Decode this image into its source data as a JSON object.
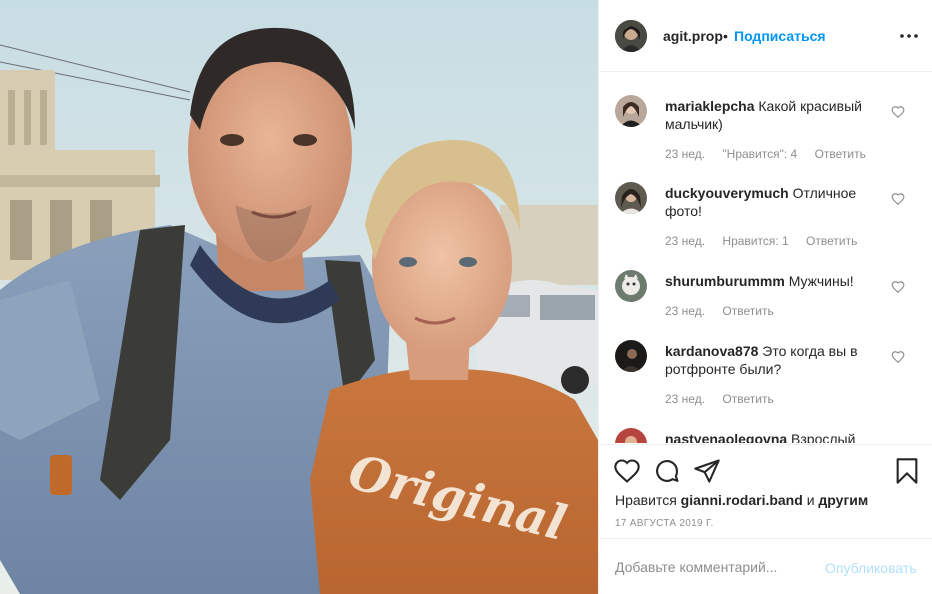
{
  "post": {
    "photo_name": "selfie-photo",
    "shirt_print": "Original"
  },
  "header": {
    "username": "agit.prop",
    "separator": "•",
    "follow_label": "Подписаться",
    "more_icon": "more-horizontal-icon"
  },
  "comments": [
    {
      "username": "mariaklepcha",
      "text": "Какой красивый мальчик)",
      "age": "23 нед.",
      "likes": "\"Нравится\": 4",
      "reply": "Ответить"
    },
    {
      "username": "duckyouverymuch",
      "text": "Отличное фото!",
      "age": "23 нед.",
      "likes": "Нравится: 1",
      "reply": "Ответить"
    },
    {
      "username": "shurumburummm",
      "text": "Мужчины!",
      "age": "23 нед.",
      "likes": "",
      "reply": "Ответить"
    },
    {
      "username": "kardanova878",
      "text": "Это когда вы в ротфронте были?",
      "age": "23 нед.",
      "likes": "",
      "reply": "Ответить"
    },
    {
      "username": "nastyenaolegovna",
      "text": "Взрослый",
      "age": "",
      "likes": "",
      "reply": ""
    }
  ],
  "actions": {
    "like_icon": "heart-icon",
    "comment_icon": "comment-bubble-icon",
    "share_icon": "paper-plane-icon",
    "save_icon": "bookmark-icon"
  },
  "likes_line": {
    "prefix": "Нравится",
    "user": "gianni.rodari.band",
    "conj": "и",
    "others": "другим"
  },
  "date": "17 АВГУСТА 2019 Г.",
  "add_comment": {
    "placeholder": "Добавьте комментарий...",
    "publish_label": "Опубликовать"
  },
  "colors": {
    "accent": "#0095f6",
    "publish_disabled": "#b2dffc",
    "muted": "#8e8e8e",
    "text": "#262626",
    "border": "#efefef"
  }
}
